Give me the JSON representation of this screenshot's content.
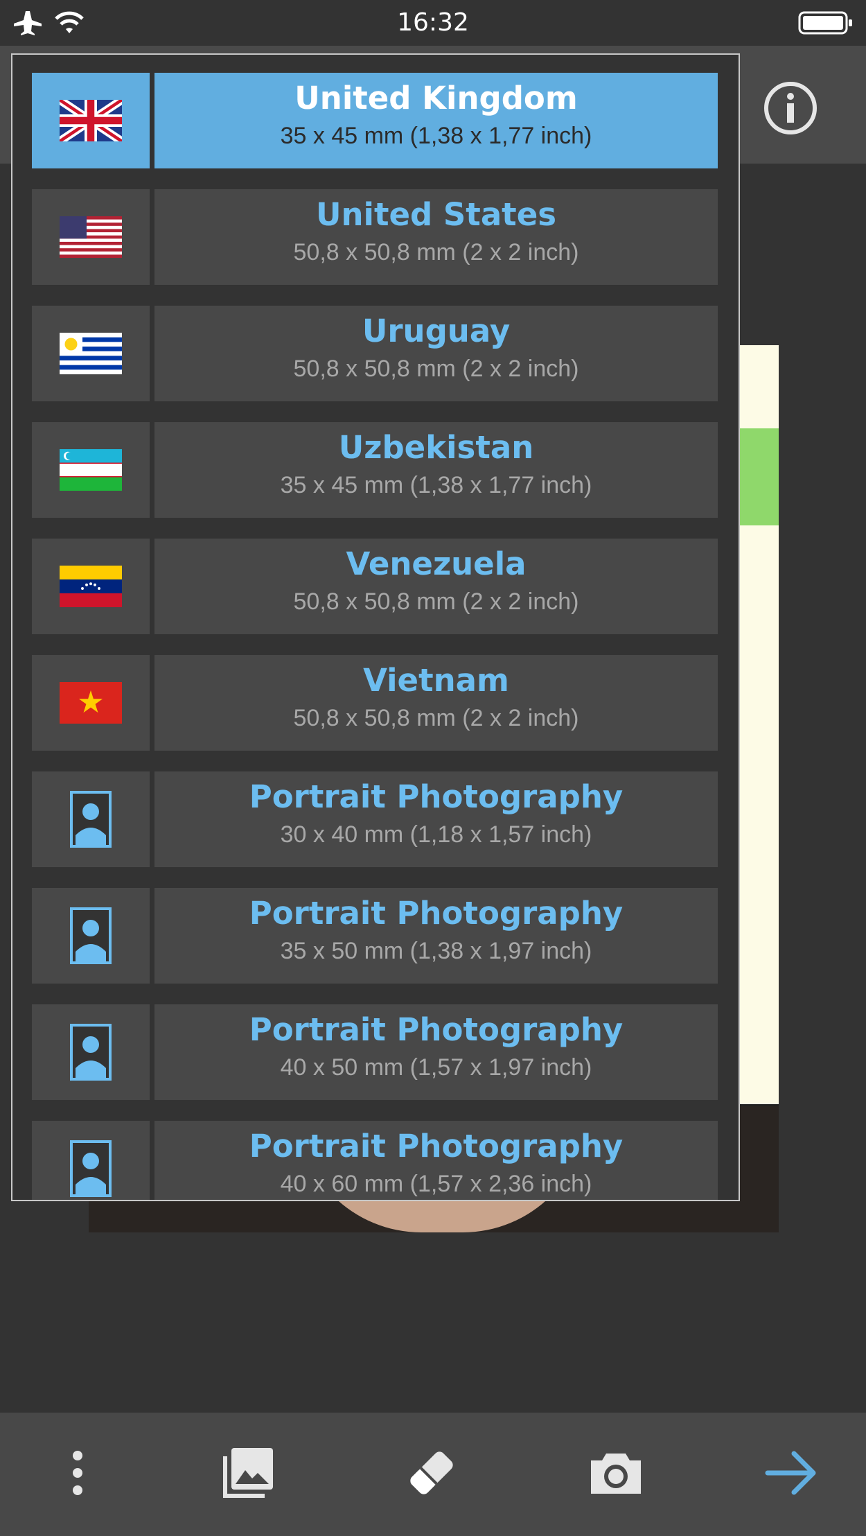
{
  "status_bar": {
    "time": "16:32",
    "icons": [
      "airplane-icon",
      "wifi-icon",
      "battery-icon"
    ]
  },
  "header": {
    "info_icon": "info-icon"
  },
  "size_list": {
    "selected_index": 0,
    "items": [
      {
        "name": "United Kingdom",
        "size": "35 x 45 mm (1,38 x 1,77 inch)",
        "icon": "flag-uk-icon"
      },
      {
        "name": "United States",
        "size": "50,8 x 50,8 mm (2 x 2 inch)",
        "icon": "flag-us-icon"
      },
      {
        "name": "Uruguay",
        "size": "50,8 x 50,8 mm (2 x 2 inch)",
        "icon": "flag-uruguay-icon"
      },
      {
        "name": "Uzbekistan",
        "size": "35 x 45 mm (1,38 x 1,77 inch)",
        "icon": "flag-uzbekistan-icon"
      },
      {
        "name": "Venezuela",
        "size": "50,8 x 50,8 mm (2 x 2 inch)",
        "icon": "flag-venezuela-icon"
      },
      {
        "name": "Vietnam",
        "size": "50,8 x 50,8 mm (2 x 2 inch)",
        "icon": "flag-vietnam-icon"
      },
      {
        "name": "Portrait Photography",
        "size": "30 x 40 mm (1,18 x 1,57 inch)",
        "icon": "portrait-icon"
      },
      {
        "name": "Portrait Photography",
        "size": "35 x 50 mm (1,38 x 1,97 inch)",
        "icon": "portrait-icon"
      },
      {
        "name": "Portrait Photography",
        "size": "40 x 50 mm (1,57 x 1,97 inch)",
        "icon": "portrait-icon"
      },
      {
        "name": "Portrait Photography",
        "size": "40 x 60 mm (1,57 x 2,36 inch)",
        "icon": "portrait-icon"
      }
    ]
  },
  "toolbar": {
    "icons": [
      "more-vertical-icon",
      "gallery-icon",
      "eraser-icon",
      "camera-icon",
      "next-arrow-icon"
    ]
  },
  "colors": {
    "accent": "#61aee0",
    "label_blue": "#6cbdf0",
    "background": "#333333",
    "row_background": "#484848"
  }
}
